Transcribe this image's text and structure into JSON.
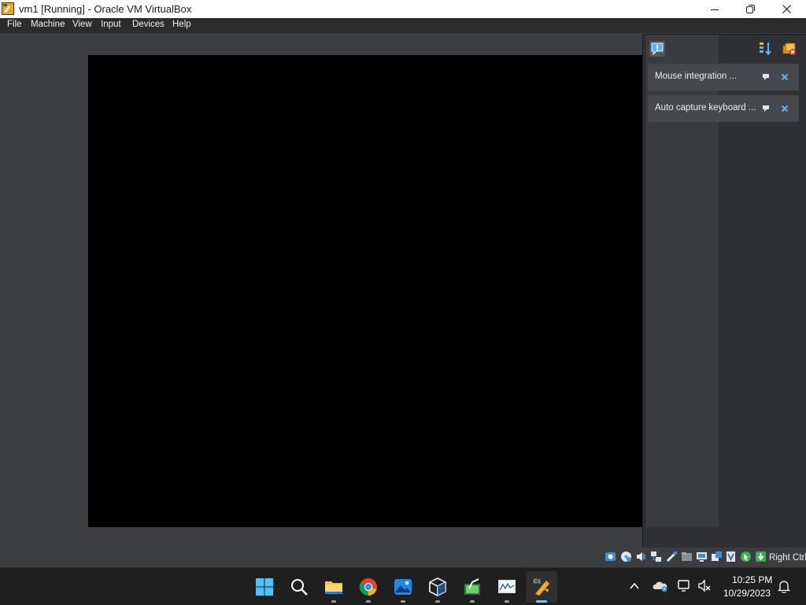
{
  "window": {
    "title": "vm1 [Running] - Oracle VM VirtualBox",
    "controls": [
      "minimize",
      "maximize",
      "close"
    ]
  },
  "menubar": {
    "items": [
      {
        "label": "File"
      },
      {
        "label": "Machine"
      },
      {
        "label": "View"
      },
      {
        "label": "Input"
      },
      {
        "label": "Devices"
      },
      {
        "label": "Help"
      }
    ]
  },
  "notification_center": {
    "toolbar_icons": [
      "notification-center-icon",
      "sort-icon",
      "clear-all-icon"
    ],
    "items": [
      {
        "label": "Mouse integration ...",
        "actions": [
          "pin-icon",
          "close-icon"
        ]
      },
      {
        "label": "Auto capture keyboard ...",
        "actions": [
          "pin-icon",
          "close-icon"
        ]
      }
    ]
  },
  "statusbar": {
    "icons": [
      "hard-disk-icon",
      "optical-drive-icon",
      "audio-icon",
      "network-icon",
      "usb-icon",
      "shared-folders-icon",
      "display-icon",
      "recording-icon",
      "virtualization-icon",
      "mouse-integration-icon",
      "keyboard-capture-icon"
    ],
    "host_key": "Right Ctrl"
  },
  "taskbar": {
    "apps": [
      "start-icon",
      "search-icon",
      "file-explorer-icon",
      "chrome-icon",
      "photos-icon",
      "virtualbox-manager-icon",
      "task-manager-icon",
      "performance-monitor-icon",
      "virtualbox-vm-icon"
    ],
    "active_app": "virtualbox-vm-icon",
    "tray_icons": [
      "show-hidden-icons-icon",
      "onedrive-icon",
      "network-icon",
      "volume-muted-icon",
      "notifications-icon"
    ],
    "time": "10:25 PM",
    "date": "10/29/2023"
  },
  "colors": {
    "accent": "#60cdff",
    "background": "#3b3d40",
    "vm_screen": "#000000",
    "taskbar": "#1f1f1f"
  }
}
